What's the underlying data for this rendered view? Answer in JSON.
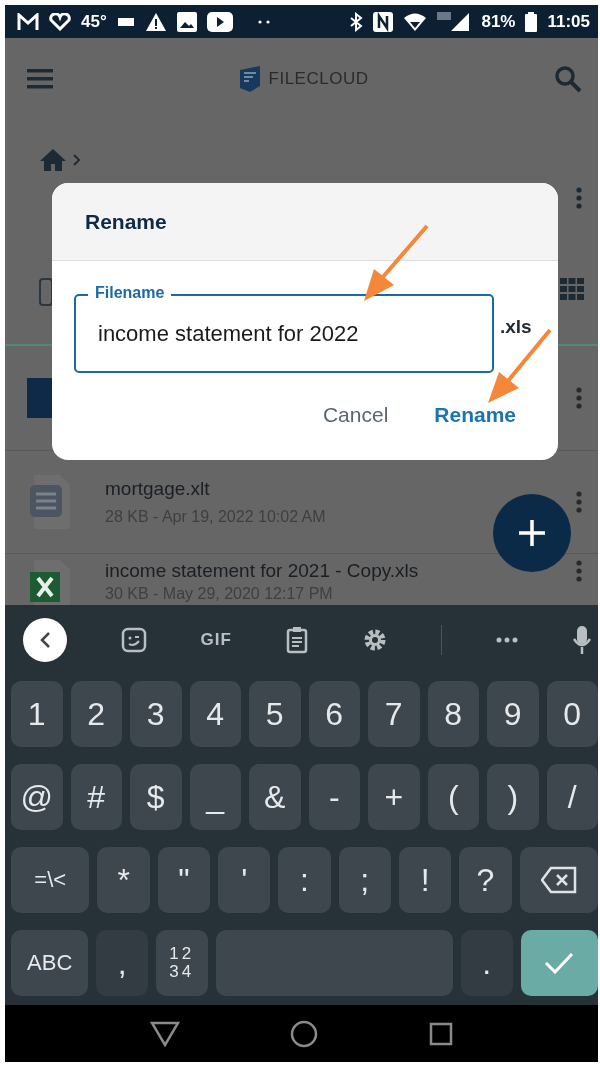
{
  "status_bar": {
    "temperature": "45°",
    "battery": "81%",
    "time": "11:05"
  },
  "app_bar": {
    "logo_text": "FILECLOUD"
  },
  "toolbar": {
    "select_all": {
      "checked": false
    }
  },
  "files": [
    {
      "kind": "document",
      "name": "mortgage.xlt",
      "details": "28 KB - Apr 19, 2022 10:02 AM"
    },
    {
      "kind": "spreadsheet",
      "name": "income statement for 2021 - Copy.xls",
      "details": "30 KB - May 29, 2020 12:17 PM"
    }
  ],
  "dialog": {
    "title": "Rename",
    "field": {
      "label": "Filename",
      "value": "income statement for 2022",
      "focused": true
    },
    "extension": ".xls",
    "buttons": [
      {
        "label": "Cancel",
        "primary": false
      },
      {
        "label": "Rename",
        "primary": true
      }
    ]
  },
  "keyboard": {
    "toolbar": {
      "gif": "GIF"
    },
    "rows": [
      [
        {
          "kind": "char",
          "label": "1"
        },
        {
          "kind": "char",
          "label": "2"
        },
        {
          "kind": "char",
          "label": "3"
        },
        {
          "kind": "char",
          "label": "4"
        },
        {
          "kind": "char",
          "label": "5"
        },
        {
          "kind": "char",
          "label": "6"
        },
        {
          "kind": "char",
          "label": "7"
        },
        {
          "kind": "char",
          "label": "8"
        },
        {
          "kind": "char",
          "label": "9"
        },
        {
          "kind": "char",
          "label": "0"
        }
      ],
      [
        {
          "kind": "char",
          "label": "@"
        },
        {
          "kind": "char",
          "label": "#"
        },
        {
          "kind": "char",
          "label": "$"
        },
        {
          "kind": "char",
          "label": "_"
        },
        {
          "kind": "char",
          "label": "&"
        },
        {
          "kind": "char",
          "label": "-"
        },
        {
          "kind": "char",
          "label": "+"
        },
        {
          "kind": "char",
          "label": "("
        },
        {
          "kind": "char",
          "label": ")"
        },
        {
          "kind": "char",
          "label": "/"
        }
      ],
      [
        {
          "kind": "wide",
          "label": "=\\<"
        },
        {
          "kind": "char",
          "label": "*"
        },
        {
          "kind": "char",
          "label": "\""
        },
        {
          "kind": "char",
          "label": "'"
        },
        {
          "kind": "char",
          "label": ":"
        },
        {
          "kind": "char",
          "label": ";"
        },
        {
          "kind": "char",
          "label": "!"
        },
        {
          "kind": "char",
          "label": "?"
        },
        {
          "kind": "backspace"
        }
      ],
      [
        {
          "kind": "wide",
          "label": "ABC"
        },
        {
          "kind": "char",
          "label": ","
        },
        {
          "kind": "stacked",
          "label": "12\n34"
        },
        {
          "kind": "space"
        },
        {
          "kind": "char",
          "label": "."
        },
        {
          "kind": "enter"
        }
      ]
    ]
  }
}
